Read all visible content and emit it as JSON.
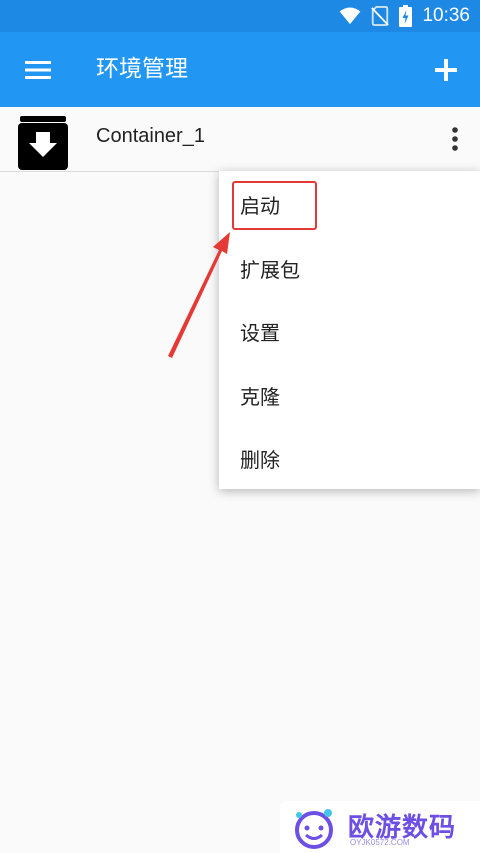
{
  "status_bar": {
    "time": "10:36",
    "icons": [
      "wifi-icon",
      "no-sim-icon",
      "battery-charging-icon"
    ]
  },
  "app_bar": {
    "title": "环境管理",
    "menu_icon": "hamburger-icon",
    "add_icon": "plus-icon"
  },
  "list": {
    "items": [
      {
        "label": "Container_1",
        "icon": "archive-download-icon",
        "more_icon": "more-vert-icon"
      }
    ]
  },
  "popup_menu": {
    "items": [
      {
        "label": "启动",
        "highlighted": true
      },
      {
        "label": "扩展包"
      },
      {
        "label": "设置"
      },
      {
        "label": "克隆"
      },
      {
        "label": "删除"
      }
    ]
  },
  "annotation": {
    "highlight_color": "#e53935",
    "arrow_color": "#e53935"
  },
  "watermark": {
    "text": "欧游数码",
    "subtext": "OYJK0572.COM"
  },
  "colors": {
    "status_bar": "#1e88e5",
    "app_bar": "#2196f3",
    "background": "#fafafa",
    "watermark": "#6d4fe3"
  }
}
